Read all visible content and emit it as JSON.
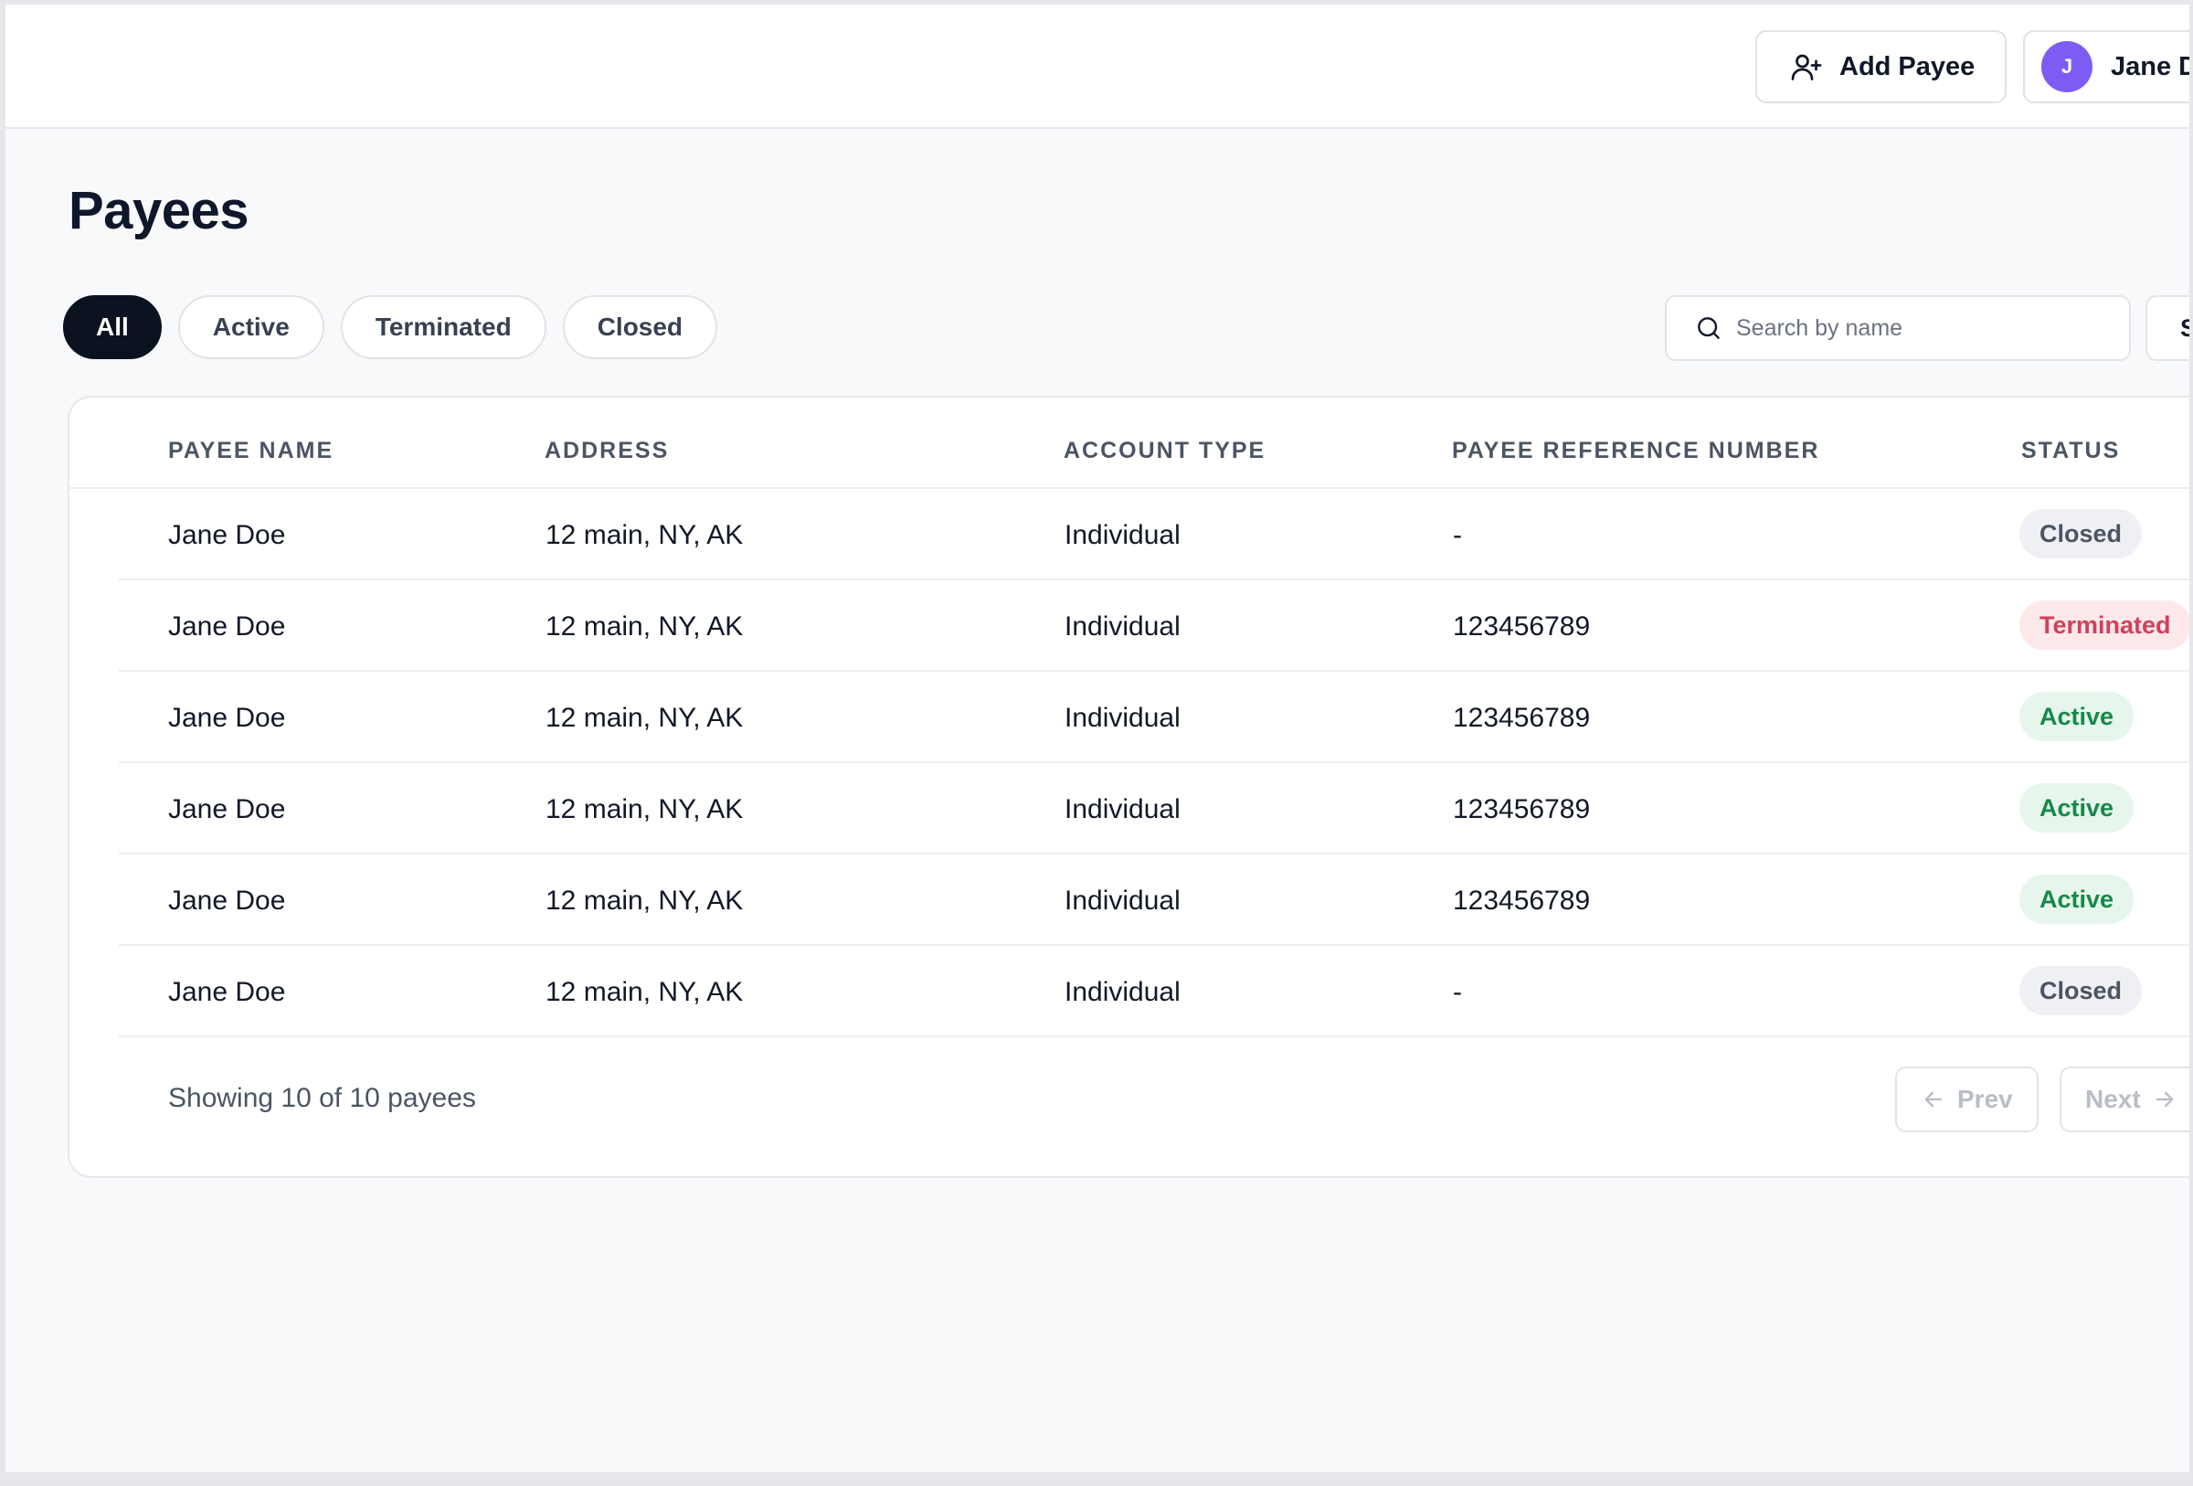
{
  "header": {
    "add_payee_label": "Add Payee",
    "user": {
      "initial": "J",
      "name": "Jane Doe"
    }
  },
  "page": {
    "title": "Payees"
  },
  "filters": [
    {
      "label": "All",
      "selected": true
    },
    {
      "label": "Active",
      "selected": false
    },
    {
      "label": "Terminated",
      "selected": false
    },
    {
      "label": "Closed",
      "selected": false
    }
  ],
  "search": {
    "placeholder": "Search by name",
    "value": ""
  },
  "sort": {
    "label": "Sort"
  },
  "table": {
    "columns": [
      "PAYEE NAME",
      "ADDRESS",
      "ACCOUNT TYPE",
      "PAYEE REFERENCE NUMBER",
      "STATUS"
    ],
    "rows": [
      {
        "name": "Jane Doe",
        "address": "12 main, NY, AK",
        "account_type": "Individual",
        "reference": "-",
        "status": "Closed"
      },
      {
        "name": "Jane Doe",
        "address": "12 main, NY, AK",
        "account_type": "Individual",
        "reference": "123456789",
        "status": "Terminated"
      },
      {
        "name": "Jane Doe",
        "address": "12 main, NY, AK",
        "account_type": "Individual",
        "reference": "123456789",
        "status": "Active"
      },
      {
        "name": "Jane Doe",
        "address": "12 main, NY, AK",
        "account_type": "Individual",
        "reference": "123456789",
        "status": "Active"
      },
      {
        "name": "Jane Doe",
        "address": "12 main, NY, AK",
        "account_type": "Individual",
        "reference": "123456789",
        "status": "Active"
      },
      {
        "name": "Jane Doe",
        "address": "12 main, NY, AK",
        "account_type": "Individual",
        "reference": "-",
        "status": "Closed"
      }
    ]
  },
  "pagination": {
    "summary": "Showing 10 of 10 payees",
    "prev_label": "Prev",
    "next_label": "Next"
  },
  "colors": {
    "primary_dark": "#0b1220",
    "avatar": "#7c5cf2",
    "status_active": "#16894a",
    "status_terminated": "#d0415a",
    "status_closed": "#4b5563"
  }
}
